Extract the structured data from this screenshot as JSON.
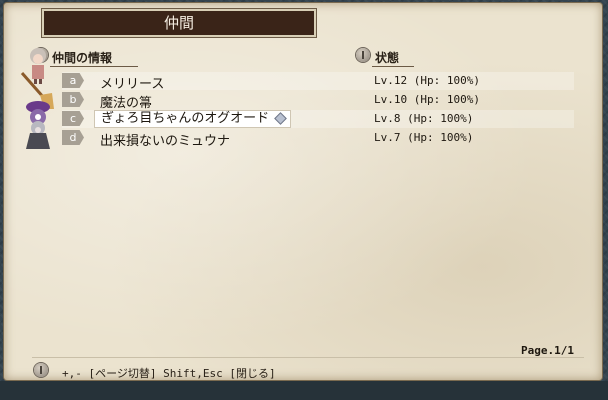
{
  "title": "仲間",
  "headers": {
    "party_info": "仲間の情報",
    "status": "状態"
  },
  "members": [
    {
      "key": "a",
      "name": "メリリース",
      "level": "Lv.12",
      "hp": "(Hp: 100%)",
      "selected": false
    },
    {
      "key": "b",
      "name": "魔法の箒",
      "level": "Lv.10",
      "hp": "(Hp: 100%)",
      "selected": false
    },
    {
      "key": "c",
      "name": "ぎょろ目ちゃんのオグオード",
      "level": "Lv.8",
      "hp": "(Hp: 100%)",
      "selected": true
    },
    {
      "key": "d",
      "name": "出来損ないのミュウナ",
      "level": "Lv.7",
      "hp": "(Hp: 100%)",
      "selected": false
    }
  ],
  "page": "Page.1/1",
  "footer_hint": "+,- [ページ切替]  Shift,Esc [閉じる]"
}
